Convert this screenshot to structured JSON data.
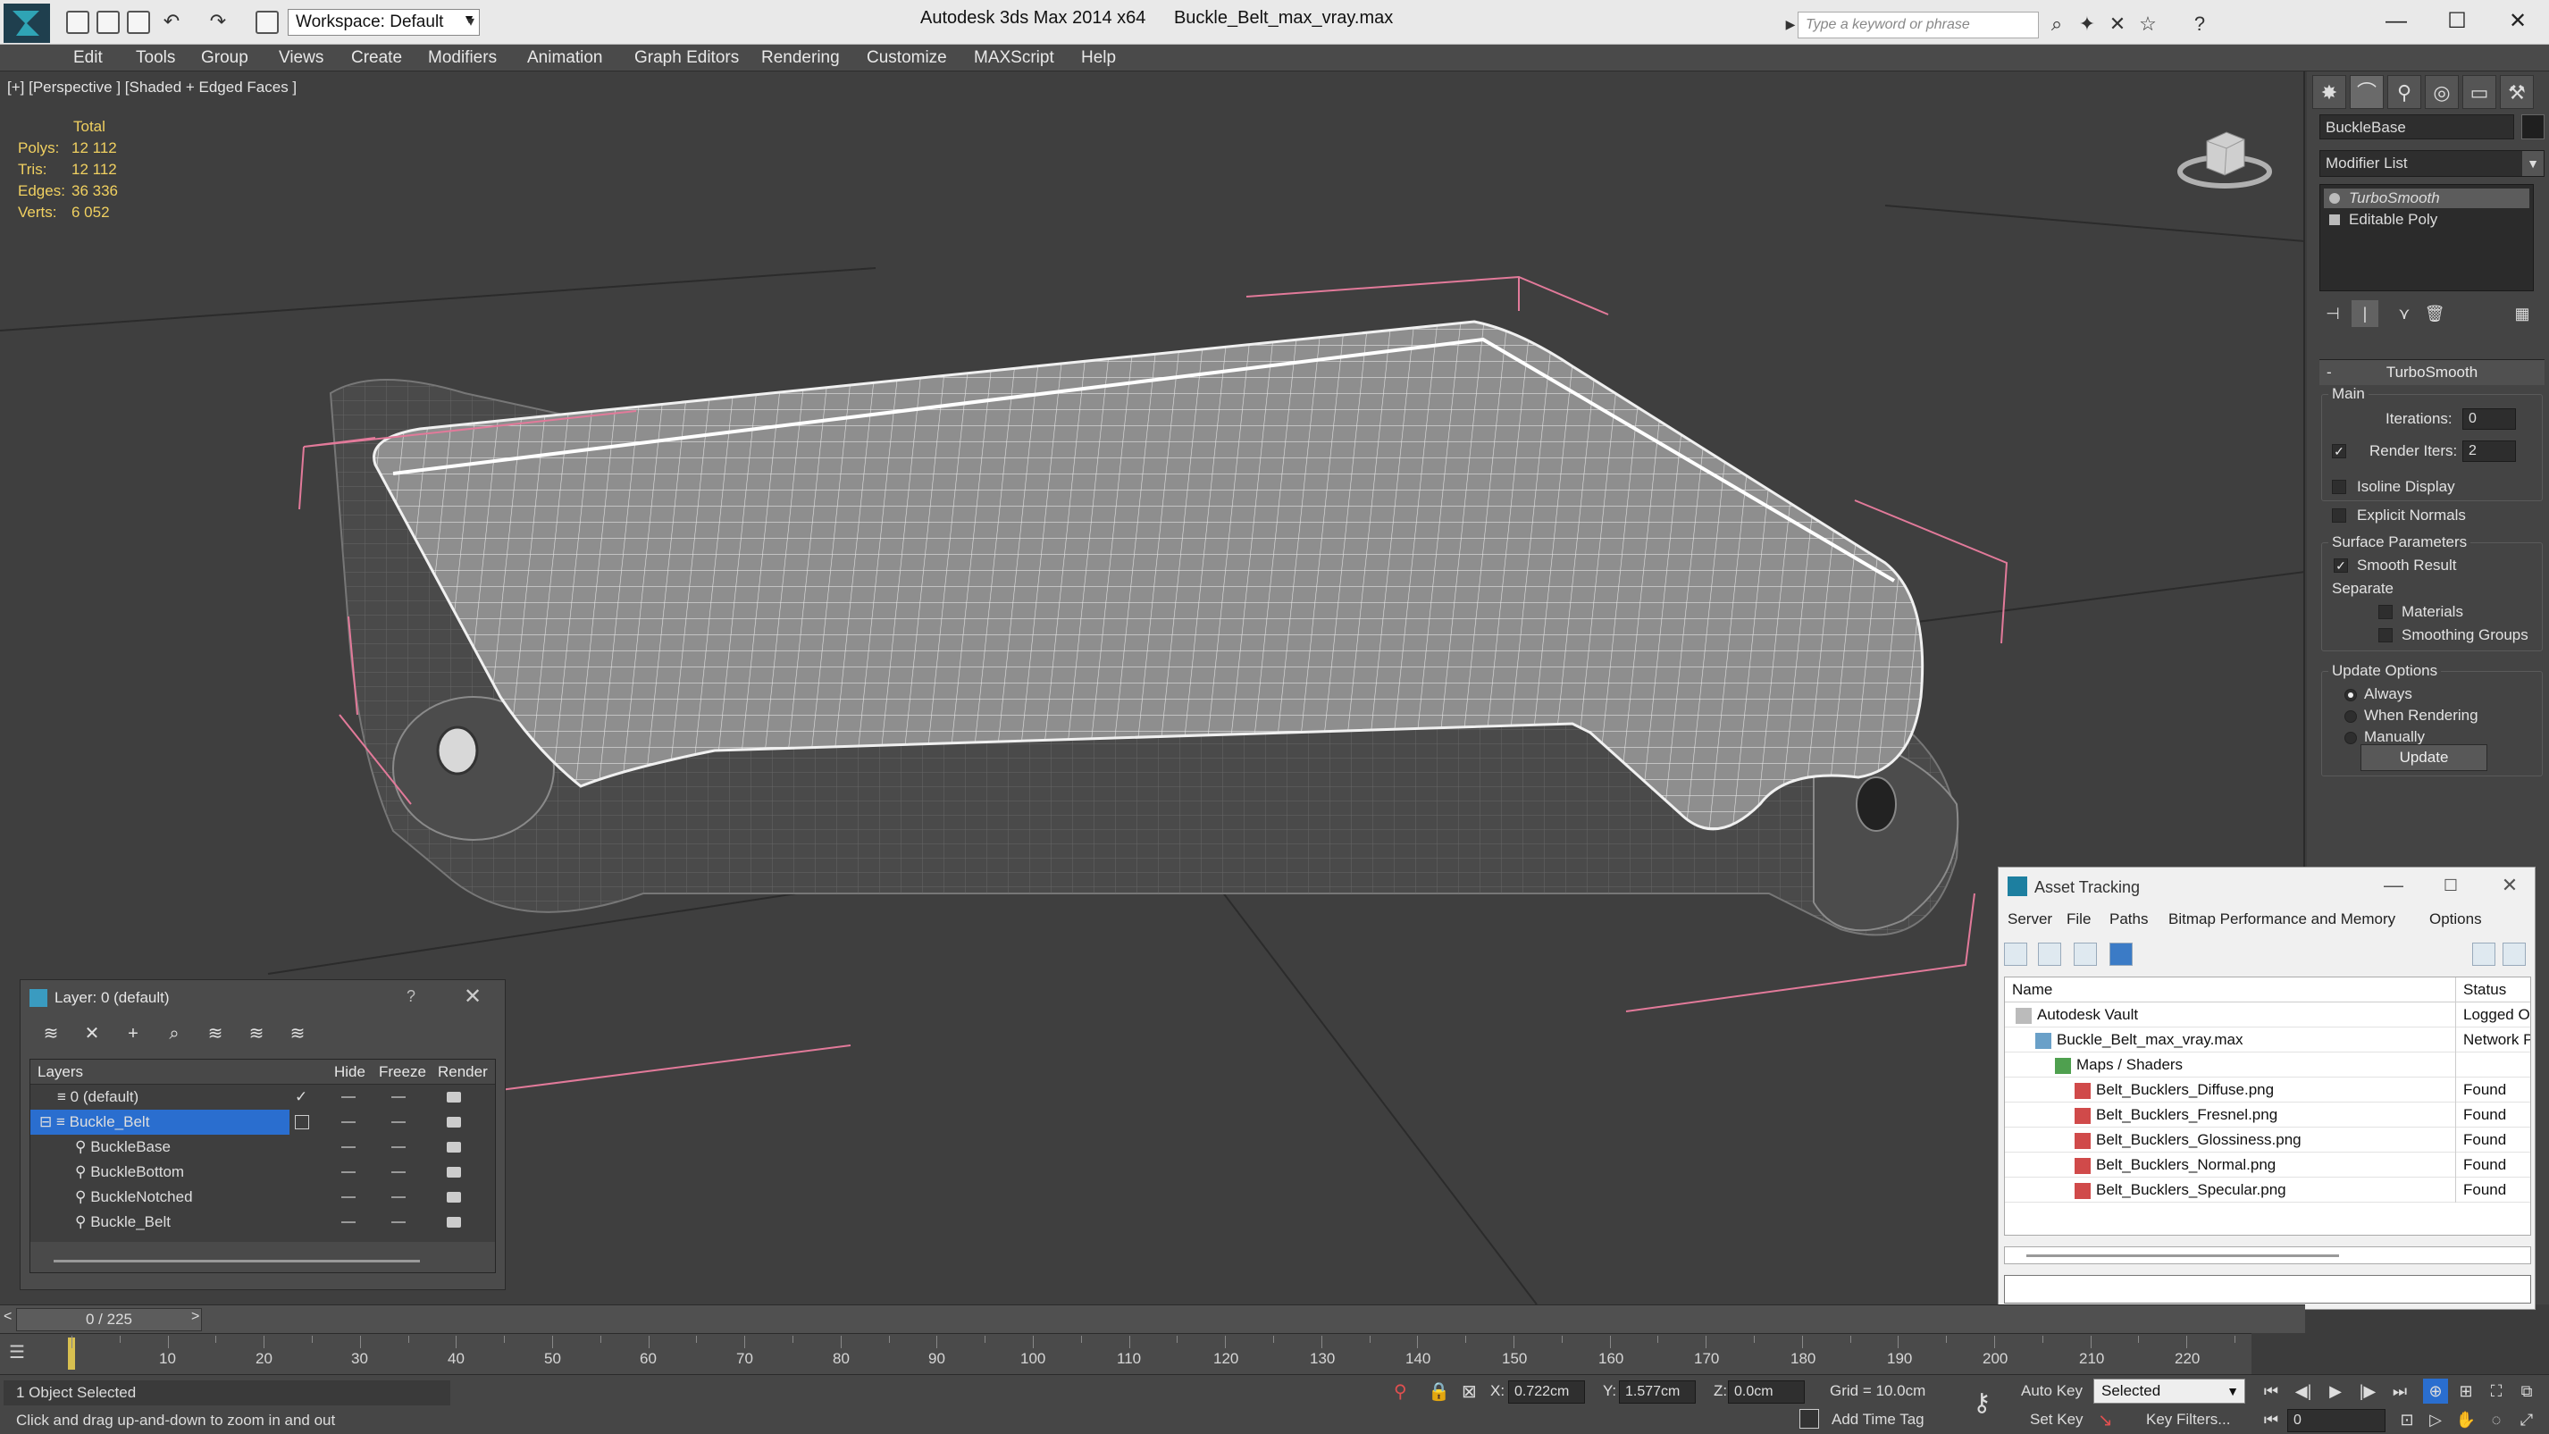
{
  "titlebar": {
    "workspace": "Workspace: Default",
    "app_name": "Autodesk 3ds Max  2014 x64",
    "file_name": "Buckle_Belt_max_vray.max",
    "search_placeholder": "Type a keyword or phrase"
  },
  "menu": [
    "Edit",
    "Tools",
    "Group",
    "Views",
    "Create",
    "Modifiers",
    "Animation",
    "Graph Editors",
    "Rendering",
    "Customize",
    "MAXScript",
    "Help"
  ],
  "viewport": {
    "label": "[+] [Perspective ] [Shaded + Edged Faces ]",
    "stats": {
      "header": "Total",
      "rows": [
        {
          "label": "Polys:",
          "value": "12 112"
        },
        {
          "label": "Tris:",
          "value": "12 112"
        },
        {
          "label": "Edges:",
          "value": "36 336"
        },
        {
          "label": "Verts:",
          "value": "6 052"
        }
      ]
    }
  },
  "command_panel": {
    "object_name": "BuckleBase",
    "modifier_list": "Modifier List",
    "stack": [
      "TurboSmooth",
      "Editable Poly"
    ],
    "turbosmooth": {
      "title": "TurboSmooth",
      "main_label": "Main",
      "iterations_label": "Iterations:",
      "iterations_value": "0",
      "render_iters_label": "Render Iters:",
      "render_iters_value": "2",
      "isoline": "Isoline Display",
      "explicit_normals": "Explicit Normals",
      "surface_params": "Surface Parameters",
      "smooth_result": "Smooth Result",
      "separate": "Separate",
      "materials": "Materials",
      "smoothing_groups": "Smoothing Groups",
      "update_options": "Update Options",
      "always": "Always",
      "when_rendering": "When Rendering",
      "manually": "Manually",
      "update_button": "Update"
    }
  },
  "asset_tracking": {
    "title": "Asset Tracking",
    "menu": [
      "Server",
      "File",
      "Paths",
      "Bitmap Performance and Memory",
      "Options"
    ],
    "columns": [
      "Name",
      "Status"
    ],
    "rows": [
      {
        "name": "Autodesk Vault",
        "status": "Logged Ou"
      },
      {
        "name": "Buckle_Belt_max_vray.max",
        "status": "Network P"
      },
      {
        "name": "Maps / Shaders",
        "status": ""
      },
      {
        "name": "Belt_Bucklers_Diffuse.png",
        "status": "Found"
      },
      {
        "name": "Belt_Bucklers_Fresnel.png",
        "status": "Found"
      },
      {
        "name": "Belt_Bucklers_Glossiness.png",
        "status": "Found"
      },
      {
        "name": "Belt_Bucklers_Normal.png",
        "status": "Found"
      },
      {
        "name": "Belt_Bucklers_Specular.png",
        "status": "Found"
      }
    ]
  },
  "layer_window": {
    "title": "Layer: 0 (default)",
    "help": "?",
    "columns": [
      "Layers",
      "Hide",
      "Freeze",
      "Render"
    ],
    "rows": [
      {
        "name": "0 (default)"
      },
      {
        "name": "Buckle_Belt"
      },
      {
        "name": "BuckleBase"
      },
      {
        "name": "BuckleBottom"
      },
      {
        "name": "BuckleNotched"
      },
      {
        "name": "Buckle_Belt"
      }
    ]
  },
  "timeline": {
    "frame": "0 / 225",
    "ticks": [
      "10",
      "20",
      "30",
      "40",
      "50",
      "60",
      "70",
      "80",
      "90",
      "100",
      "110",
      "120",
      "130",
      "140",
      "150",
      "160",
      "170",
      "180",
      "190",
      "200",
      "210",
      "220"
    ]
  },
  "status": {
    "selected": "1 Object Selected",
    "prompt": "Click and drag up-and-down to zoom in and out",
    "x_label": "X:",
    "x": "0.722cm",
    "y_label": "Y:",
    "y": "1.577cm",
    "z_label": "Z:",
    "z": "0.0cm",
    "grid": "Grid = 10.0cm",
    "auto_key": "Auto Key",
    "set_key": "Set Key",
    "selected_set": "Selected",
    "key_filters": "Key Filters...",
    "frame_value": "0",
    "add_time_tag": "Add Time Tag"
  }
}
